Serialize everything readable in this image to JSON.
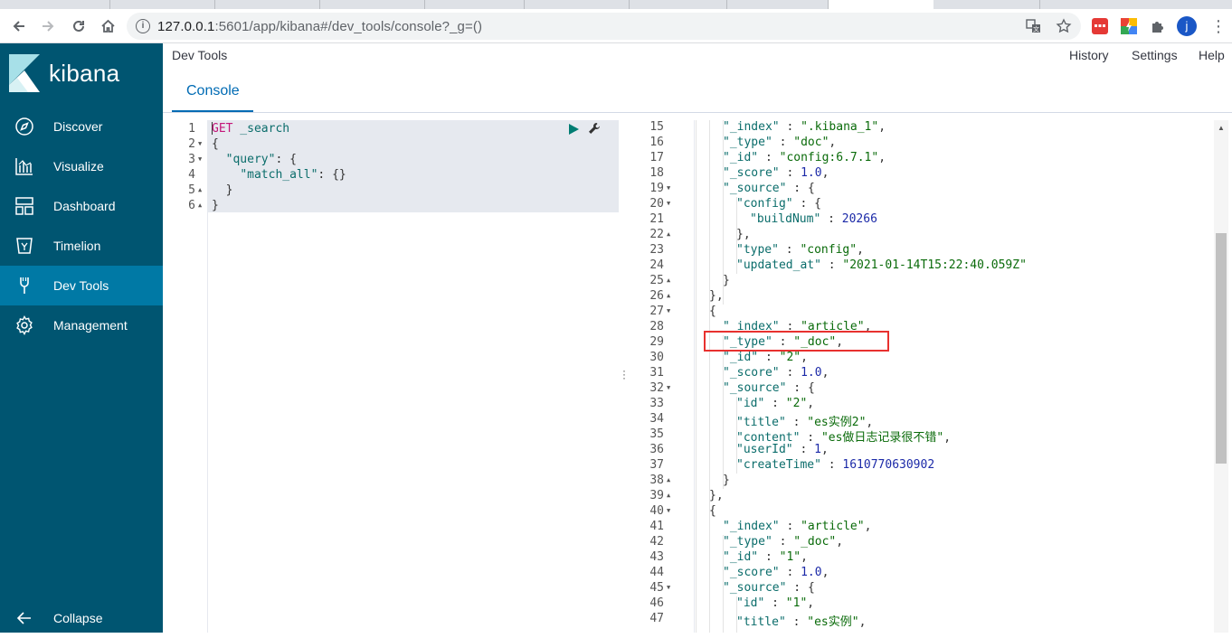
{
  "browser": {
    "url_host": "127.0.0.1",
    "url_path": ":5601/app/kibana#/dev_tools/console?_g=()",
    "avatar_letter": "j"
  },
  "sidebar": {
    "brand": "kibana",
    "items": [
      {
        "label": "Discover",
        "icon": "compass-icon"
      },
      {
        "label": "Visualize",
        "icon": "visualize-icon"
      },
      {
        "label": "Dashboard",
        "icon": "dashboard-icon"
      },
      {
        "label": "Timelion",
        "icon": "timelion-icon"
      },
      {
        "label": "Dev Tools",
        "icon": "wrench-icon",
        "active": true
      },
      {
        "label": "Management",
        "icon": "gear-icon"
      }
    ],
    "collapse_label": "Collapse"
  },
  "header": {
    "title": "Dev Tools",
    "links": [
      "History",
      "Settings",
      "Help"
    ],
    "tab": "Console"
  },
  "colors": {
    "sidebar": "#005571",
    "sidebar_active": "#0079a5",
    "accent": "#006bb4",
    "highlight_box": "#e8312f"
  },
  "editor": {
    "lines": [
      {
        "n": "1",
        "fold": "",
        "text": "GET _search"
      },
      {
        "n": "2",
        "fold": "▼",
        "text": "{"
      },
      {
        "n": "3",
        "fold": "▼",
        "text": "  \"query\": {"
      },
      {
        "n": "4",
        "fold": "",
        "text": "    \"match_all\": {}"
      },
      {
        "n": "5",
        "fold": "▲",
        "text": "  }"
      },
      {
        "n": "6",
        "fold": "▲",
        "text": "}"
      }
    ]
  },
  "output": {
    "lines": [
      {
        "n": "15",
        "fold": "",
        "indent": 3,
        "text": "\"_index\" : \".kibana_1\","
      },
      {
        "n": "16",
        "fold": "",
        "indent": 3,
        "text": "\"_type\" : \"doc\","
      },
      {
        "n": "17",
        "fold": "",
        "indent": 3,
        "text": "\"_id\" : \"config:6.7.1\","
      },
      {
        "n": "18",
        "fold": "",
        "indent": 3,
        "text": "\"_score\" : 1.0,"
      },
      {
        "n": "19",
        "fold": "▼",
        "indent": 3,
        "text": "\"_source\" : {"
      },
      {
        "n": "20",
        "fold": "▼",
        "indent": 4,
        "text": "\"config\" : {"
      },
      {
        "n": "21",
        "fold": "",
        "indent": 5,
        "text": "\"buildNum\" : 20266"
      },
      {
        "n": "22",
        "fold": "▲",
        "indent": 4,
        "text": "},"
      },
      {
        "n": "23",
        "fold": "",
        "indent": 4,
        "text": "\"type\" : \"config\","
      },
      {
        "n": "24",
        "fold": "",
        "indent": 4,
        "text": "\"updated_at\" : \"2021-01-14T15:22:40.059Z\""
      },
      {
        "n": "25",
        "fold": "▲",
        "indent": 3,
        "text": "}"
      },
      {
        "n": "26",
        "fold": "▲",
        "indent": 2,
        "text": "},"
      },
      {
        "n": "27",
        "fold": "▼",
        "indent": 2,
        "text": "{"
      },
      {
        "n": "28",
        "fold": "",
        "indent": 3,
        "text": "\"_index\" : \"article\","
      },
      {
        "n": "29",
        "fold": "",
        "indent": 3,
        "text": "\"_type\" : \"_doc\","
      },
      {
        "n": "30",
        "fold": "",
        "indent": 3,
        "text": "\"_id\" : \"2\","
      },
      {
        "n": "31",
        "fold": "",
        "indent": 3,
        "text": "\"_score\" : 1.0,"
      },
      {
        "n": "32",
        "fold": "▼",
        "indent": 3,
        "text": "\"_source\" : {"
      },
      {
        "n": "33",
        "fold": "",
        "indent": 4,
        "text": "\"id\" : \"2\","
      },
      {
        "n": "34",
        "fold": "",
        "indent": 4,
        "text": "\"title\" : \"es实例2\","
      },
      {
        "n": "35",
        "fold": "",
        "indent": 4,
        "text": "\"content\" : \"es做日志记录很不错\","
      },
      {
        "n": "36",
        "fold": "",
        "indent": 4,
        "text": "\"userId\" : 1,"
      },
      {
        "n": "37",
        "fold": "",
        "indent": 4,
        "text": "\"createTime\" : 1610770630902"
      },
      {
        "n": "38",
        "fold": "▲",
        "indent": 3,
        "text": "}"
      },
      {
        "n": "39",
        "fold": "▲",
        "indent": 2,
        "text": "},"
      },
      {
        "n": "40",
        "fold": "▼",
        "indent": 2,
        "text": "{"
      },
      {
        "n": "41",
        "fold": "",
        "indent": 3,
        "text": "\"_index\" : \"article\","
      },
      {
        "n": "42",
        "fold": "",
        "indent": 3,
        "text": "\"_type\" : \"_doc\","
      },
      {
        "n": "43",
        "fold": "",
        "indent": 3,
        "text": "\"_id\" : \"1\","
      },
      {
        "n": "44",
        "fold": "",
        "indent": 3,
        "text": "\"_score\" : 1.0,"
      },
      {
        "n": "45",
        "fold": "▼",
        "indent": 3,
        "text": "\"_source\" : {"
      },
      {
        "n": "46",
        "fold": "",
        "indent": 4,
        "text": "\"id\" : \"1\","
      },
      {
        "n": "47",
        "fold": "",
        "indent": 4,
        "text": "\"title\" : \"es实例\","
      }
    ]
  }
}
